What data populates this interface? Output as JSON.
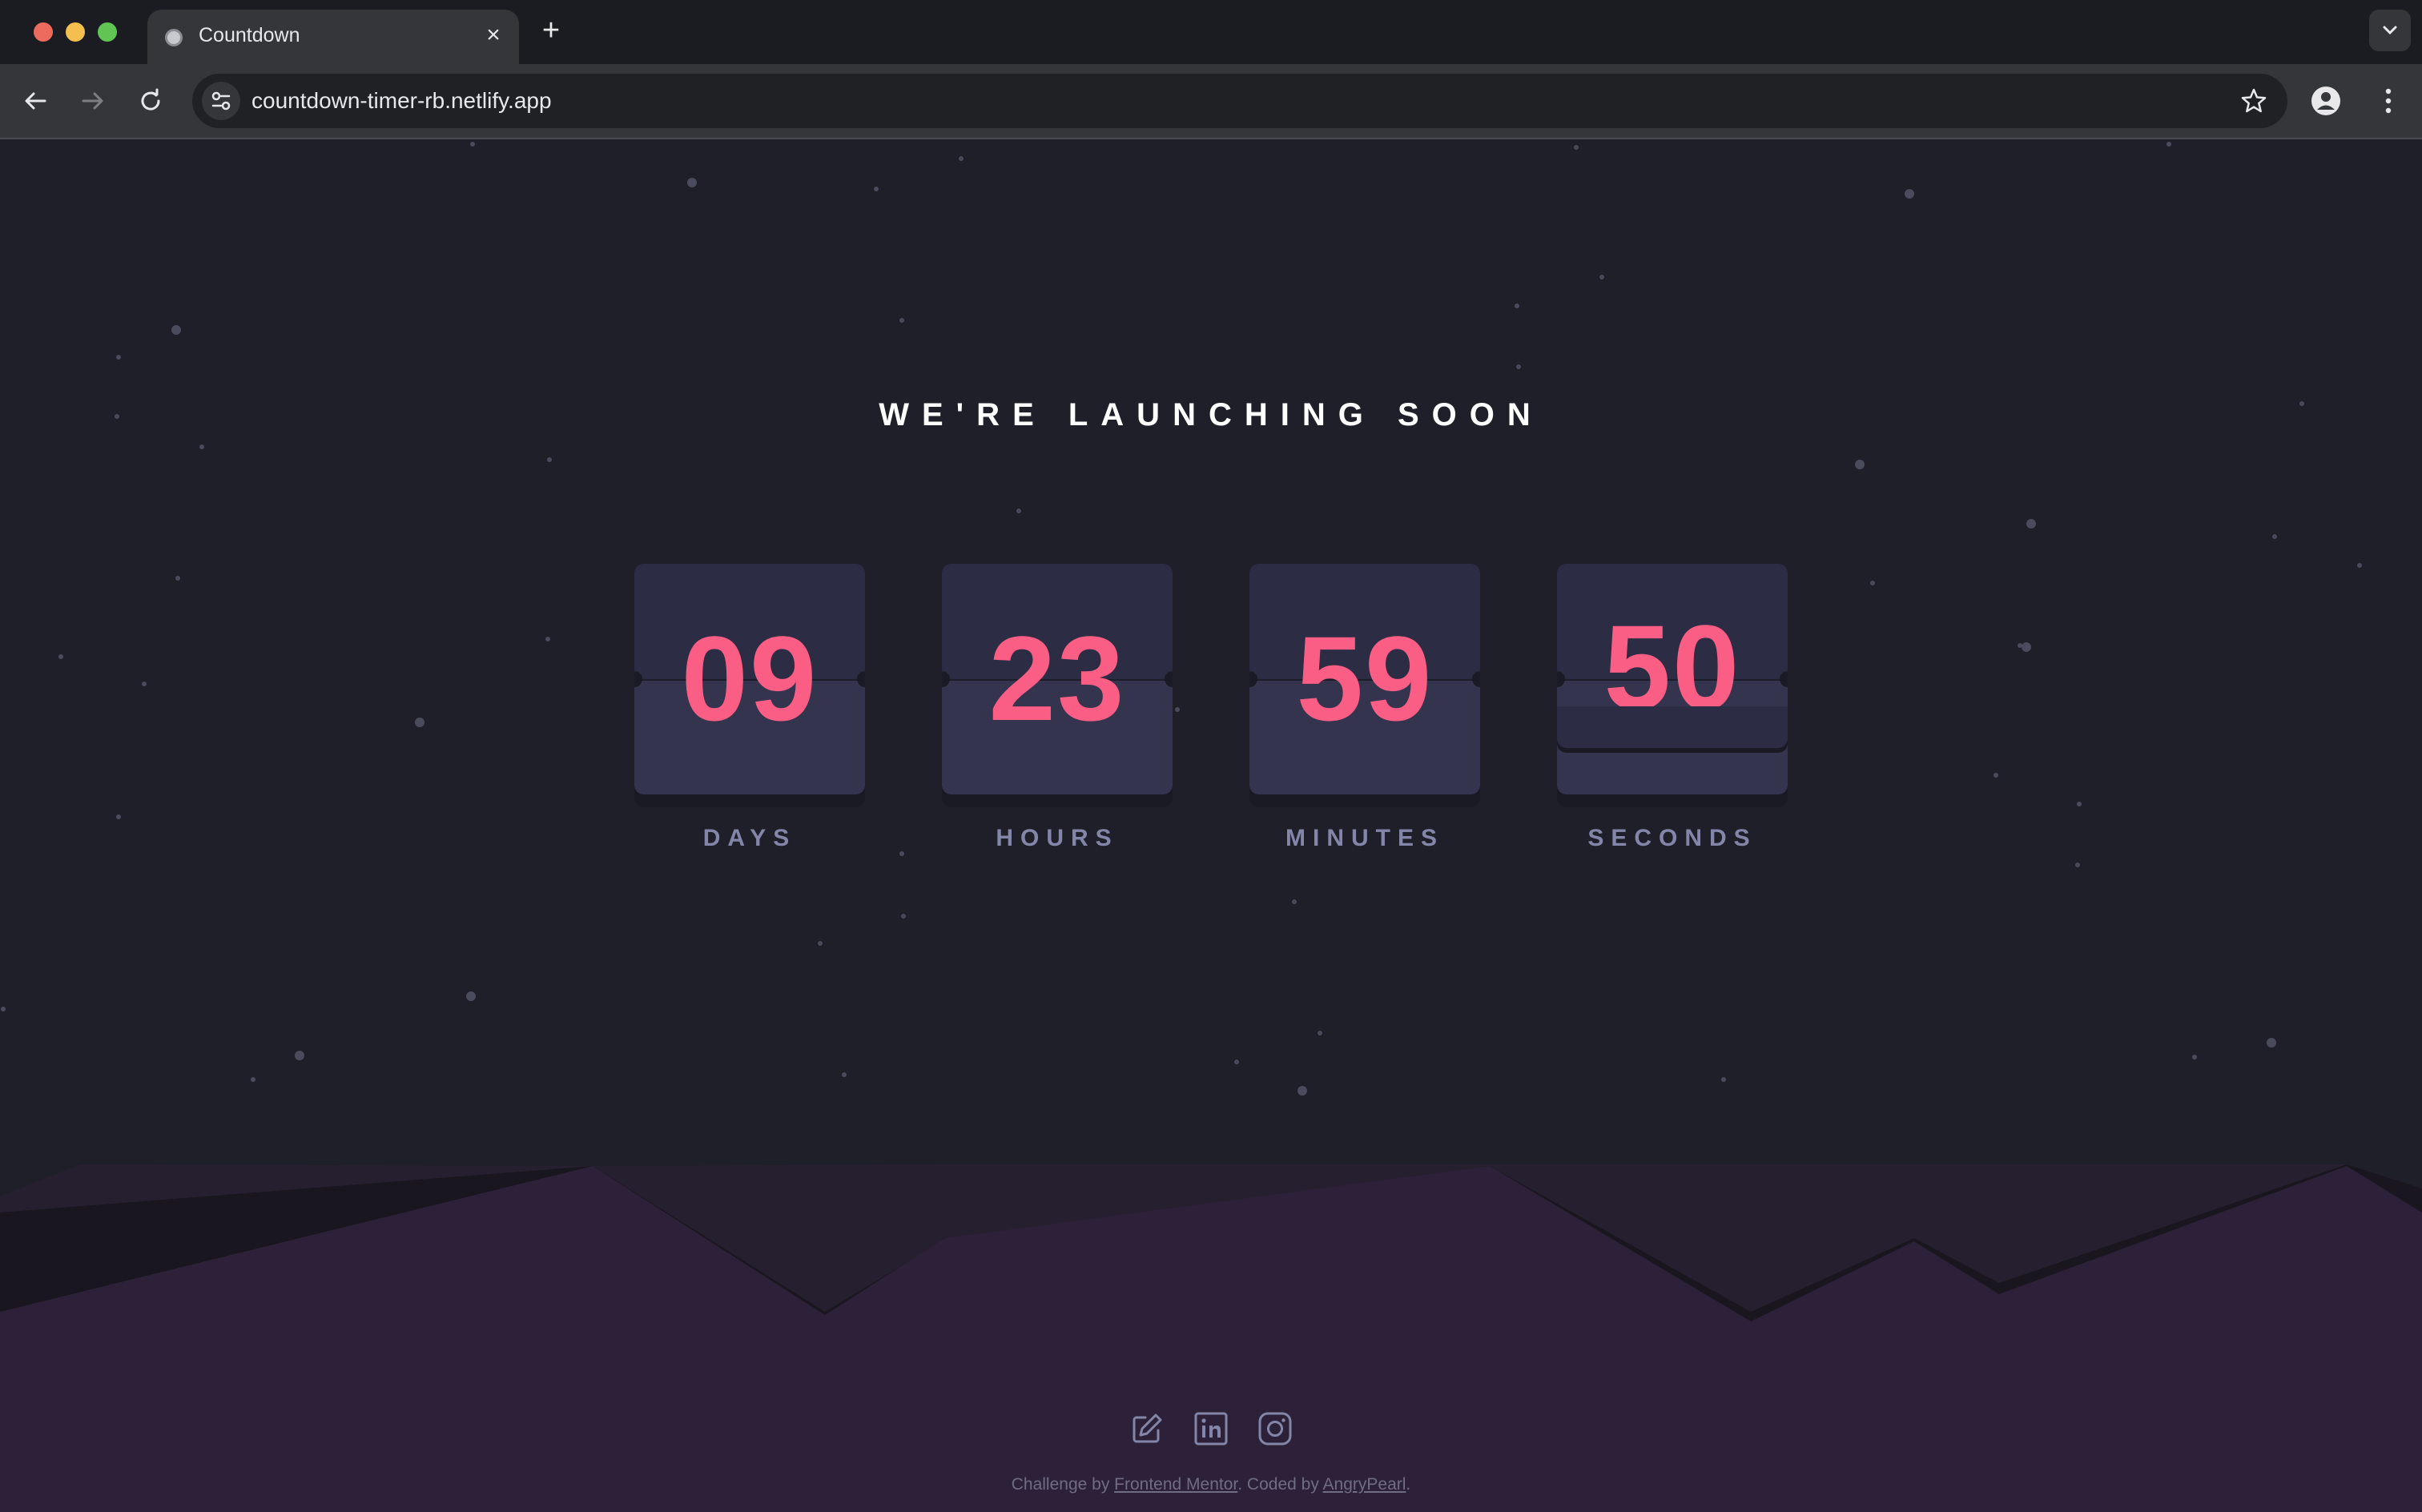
{
  "browser": {
    "tab_title": "Countdown",
    "url": "countdown-timer-rb.netlify.app"
  },
  "page": {
    "headline": "WE'RE LAUNCHING SOON",
    "countdown": [
      {
        "value": "09",
        "label": "DAYS"
      },
      {
        "value": "23",
        "label": "HOURS"
      },
      {
        "value": "59",
        "label": "MINUTES"
      },
      {
        "value": "50",
        "label": "SECONDS"
      }
    ],
    "footer": {
      "prefix": "Challenge by",
      "link1": "Frontend Mentor",
      "middle": ". Coded by",
      "link2": "AngryPearl",
      "suffix": "."
    }
  },
  "colors": {
    "accent": "#fb5e84",
    "label": "#8486a9",
    "card": "#2c2c44",
    "background": "#1f1f29",
    "hills": "#2c2138"
  },
  "icons": [
    "globe-icon",
    "close-icon",
    "plus-icon",
    "chevron-down-icon",
    "back-arrow-icon",
    "forward-arrow-icon",
    "reload-icon",
    "site-settings-icon",
    "star-icon",
    "profile-icon",
    "more-vert-icon",
    "edit-icon",
    "linkedin-icon",
    "instagram-icon"
  ]
}
